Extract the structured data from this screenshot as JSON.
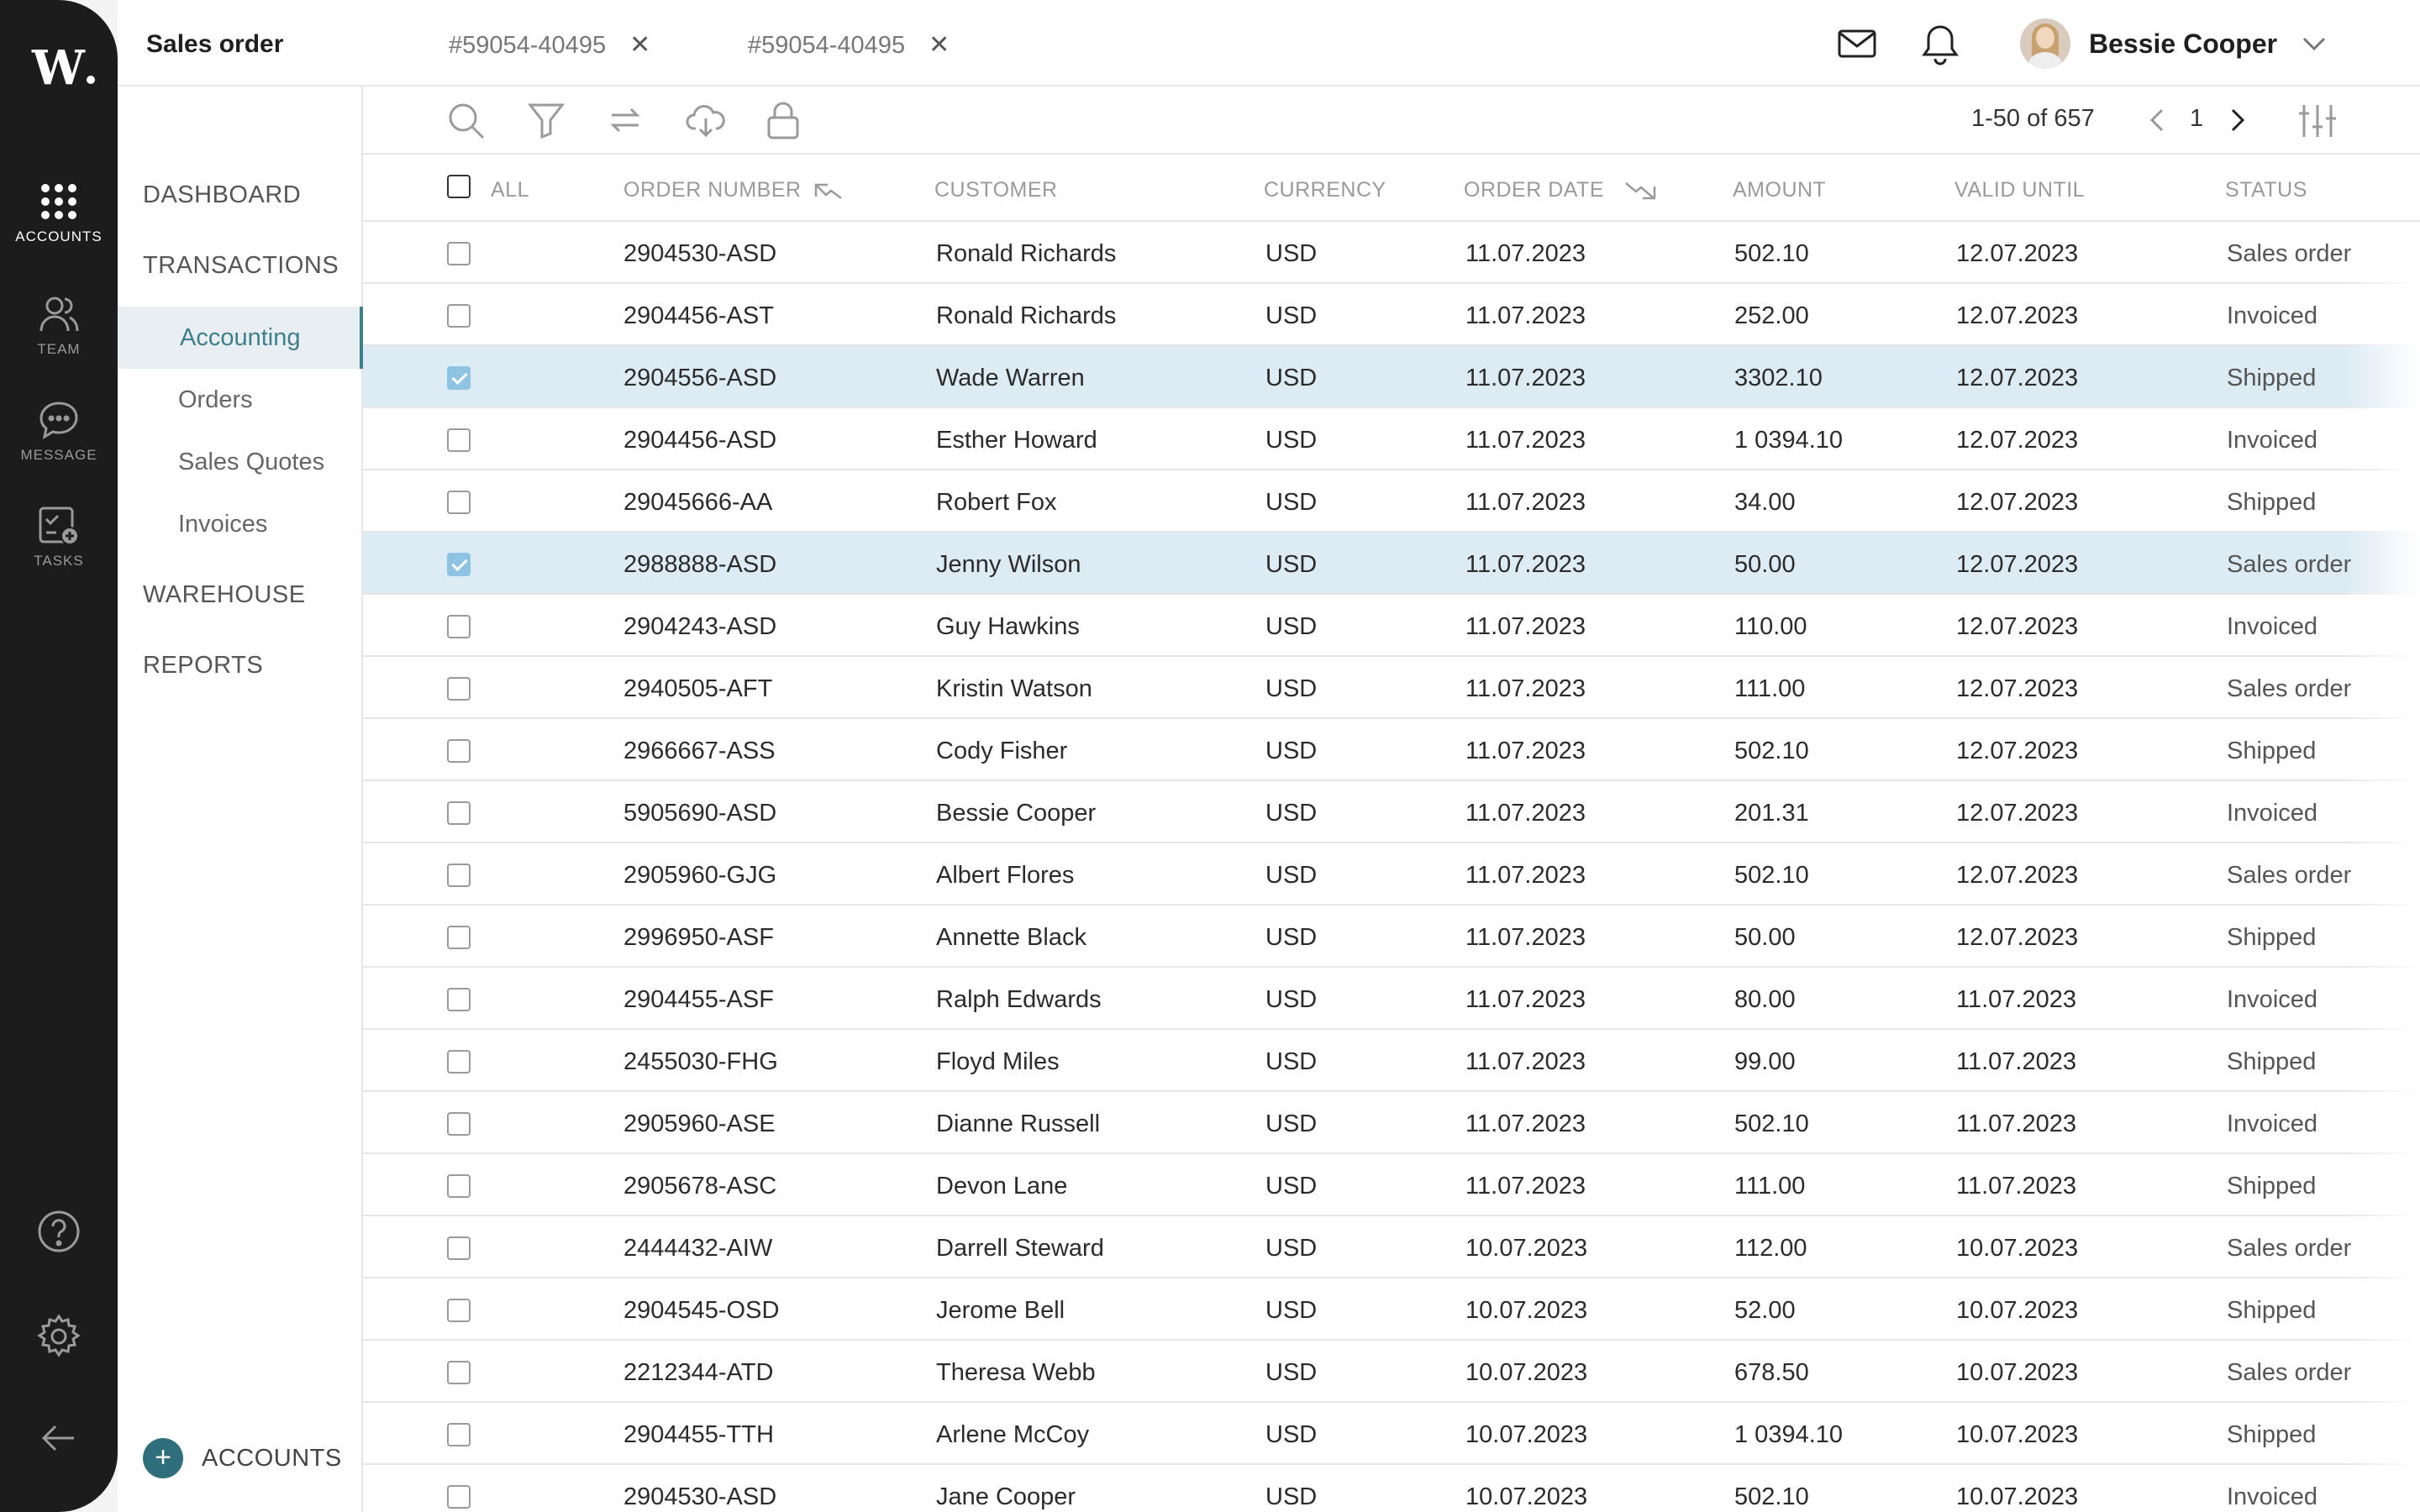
{
  "app": {
    "logo": "W",
    "colors": {
      "accent": "#3d7f8c",
      "rail": "#1c1c1c",
      "selected_row": "#dcebf4",
      "checkbox_checked": "#8ec3e3"
    }
  },
  "rail": {
    "items": [
      {
        "label": "ACCOUNTS",
        "icon": "grid-icon",
        "active": true
      },
      {
        "label": "TEAM",
        "icon": "team-icon",
        "active": false
      },
      {
        "label": "MESSAGE",
        "icon": "message-icon",
        "active": false
      },
      {
        "label": "TASKS",
        "icon": "tasks-icon",
        "active": false
      }
    ],
    "bottom_icons": [
      "help-icon",
      "settings-icon",
      "back-arrow-icon"
    ]
  },
  "header": {
    "title": "Sales order",
    "tabs": [
      {
        "label": "#59054-40495"
      },
      {
        "label": "#59054-40495"
      }
    ],
    "user_name": "Bessie Cooper"
  },
  "sidebar": {
    "sections": [
      "DASHBOARD",
      "TRANSACTIONS",
      "WAREHOUSE",
      "REPORTS"
    ],
    "transactions_items": [
      "Accounting",
      "Orders",
      "Sales Quotes",
      "Invoices"
    ],
    "active_item": "Accounting",
    "add_label": "ACCOUNTS"
  },
  "toolbar": {
    "pagination": {
      "range": "1-50 of 657",
      "page": "1"
    }
  },
  "table": {
    "columns": [
      "ALL",
      "ORDER NUMBER",
      "CUSTOMER",
      "CURRENCY",
      "ORDER DATE",
      "AMOUNT",
      "VALID UNTIL",
      "STATUS"
    ],
    "rows": [
      {
        "order": "2904530-ASD",
        "customer": "Ronald Richards",
        "currency": "USD",
        "date": "11.07.2023",
        "amount": "502.10",
        "valid": "12.07.2023",
        "status": "Sales order",
        "selected": false
      },
      {
        "order": "2904456-AST",
        "customer": "Ronald Richards",
        "currency": "USD",
        "date": "11.07.2023",
        "amount": "252.00",
        "valid": "12.07.2023",
        "status": "Invoiced",
        "selected": false
      },
      {
        "order": "2904556-ASD",
        "customer": "Wade Warren",
        "currency": "USD",
        "date": "11.07.2023",
        "amount": "3302.10",
        "valid": "12.07.2023",
        "status": "Shipped",
        "selected": true
      },
      {
        "order": "2904456-ASD",
        "customer": "Esther Howard",
        "currency": "USD",
        "date": "11.07.2023",
        "amount": "1 0394.10",
        "valid": "12.07.2023",
        "status": "Invoiced",
        "selected": false
      },
      {
        "order": "29045666-AA",
        "customer": "Robert Fox",
        "currency": "USD",
        "date": "11.07.2023",
        "amount": "34.00",
        "valid": "12.07.2023",
        "status": "Shipped",
        "selected": false
      },
      {
        "order": "2988888-ASD",
        "customer": "Jenny Wilson",
        "currency": "USD",
        "date": "11.07.2023",
        "amount": "50.00",
        "valid": "12.07.2023",
        "status": "Sales order",
        "selected": true
      },
      {
        "order": "2904243-ASD",
        "customer": "Guy Hawkins",
        "currency": "USD",
        "date": "11.07.2023",
        "amount": "110.00",
        "valid": "12.07.2023",
        "status": "Invoiced",
        "selected": false
      },
      {
        "order": "2940505-AFT",
        "customer": "Kristin Watson",
        "currency": "USD",
        "date": "11.07.2023",
        "amount": "111.00",
        "valid": "12.07.2023",
        "status": "Sales order",
        "selected": false
      },
      {
        "order": "2966667-ASS",
        "customer": "Cody Fisher",
        "currency": "USD",
        "date": "11.07.2023",
        "amount": "502.10",
        "valid": "12.07.2023",
        "status": "Shipped",
        "selected": false
      },
      {
        "order": "5905690-ASD",
        "customer": "Bessie Cooper",
        "currency": "USD",
        "date": "11.07.2023",
        "amount": "201.31",
        "valid": "12.07.2023",
        "status": "Invoiced",
        "selected": false
      },
      {
        "order": "2905960-GJG",
        "customer": "Albert Flores",
        "currency": "USD",
        "date": "11.07.2023",
        "amount": "502.10",
        "valid": "12.07.2023",
        "status": "Sales order",
        "selected": false
      },
      {
        "order": "2996950-ASF",
        "customer": "Annette Black",
        "currency": "USD",
        "date": "11.07.2023",
        "amount": "50.00",
        "valid": "12.07.2023",
        "status": "Shipped",
        "selected": false
      },
      {
        "order": "2904455-ASF",
        "customer": "Ralph Edwards",
        "currency": "USD",
        "date": "11.07.2023",
        "amount": "80.00",
        "valid": "11.07.2023",
        "status": "Invoiced",
        "selected": false
      },
      {
        "order": "2455030-FHG",
        "customer": "Floyd Miles",
        "currency": "USD",
        "date": "11.07.2023",
        "amount": "99.00",
        "valid": "11.07.2023",
        "status": "Shipped",
        "selected": false
      },
      {
        "order": "2905960-ASE",
        "customer": "Dianne Russell",
        "currency": "USD",
        "date": "11.07.2023",
        "amount": "502.10",
        "valid": "11.07.2023",
        "status": "Invoiced",
        "selected": false
      },
      {
        "order": "2905678-ASC",
        "customer": "Devon Lane",
        "currency": "USD",
        "date": "11.07.2023",
        "amount": "111.00",
        "valid": "11.07.2023",
        "status": "Shipped",
        "selected": false
      },
      {
        "order": "2444432-AIW",
        "customer": "Darrell Steward",
        "currency": "USD",
        "date": "10.07.2023",
        "amount": "112.00",
        "valid": "10.07.2023",
        "status": "Sales order",
        "selected": false
      },
      {
        "order": "2904545-OSD",
        "customer": "Jerome Bell",
        "currency": "USD",
        "date": "10.07.2023",
        "amount": "52.00",
        "valid": "10.07.2023",
        "status": "Shipped",
        "selected": false
      },
      {
        "order": "2212344-ATD",
        "customer": "Theresa Webb",
        "currency": "USD",
        "date": "10.07.2023",
        "amount": "678.50",
        "valid": "10.07.2023",
        "status": "Sales order",
        "selected": false
      },
      {
        "order": "2904455-TTH",
        "customer": "Arlene McCoy",
        "currency": "USD",
        "date": "10.07.2023",
        "amount": "1 0394.10",
        "valid": "10.07.2023",
        "status": "Shipped",
        "selected": false
      },
      {
        "order": "2904530-ASD",
        "customer": "Jane Cooper",
        "currency": "USD",
        "date": "10.07.2023",
        "amount": "502.10",
        "valid": "10.07.2023",
        "status": "Invoiced",
        "selected": false
      }
    ]
  }
}
